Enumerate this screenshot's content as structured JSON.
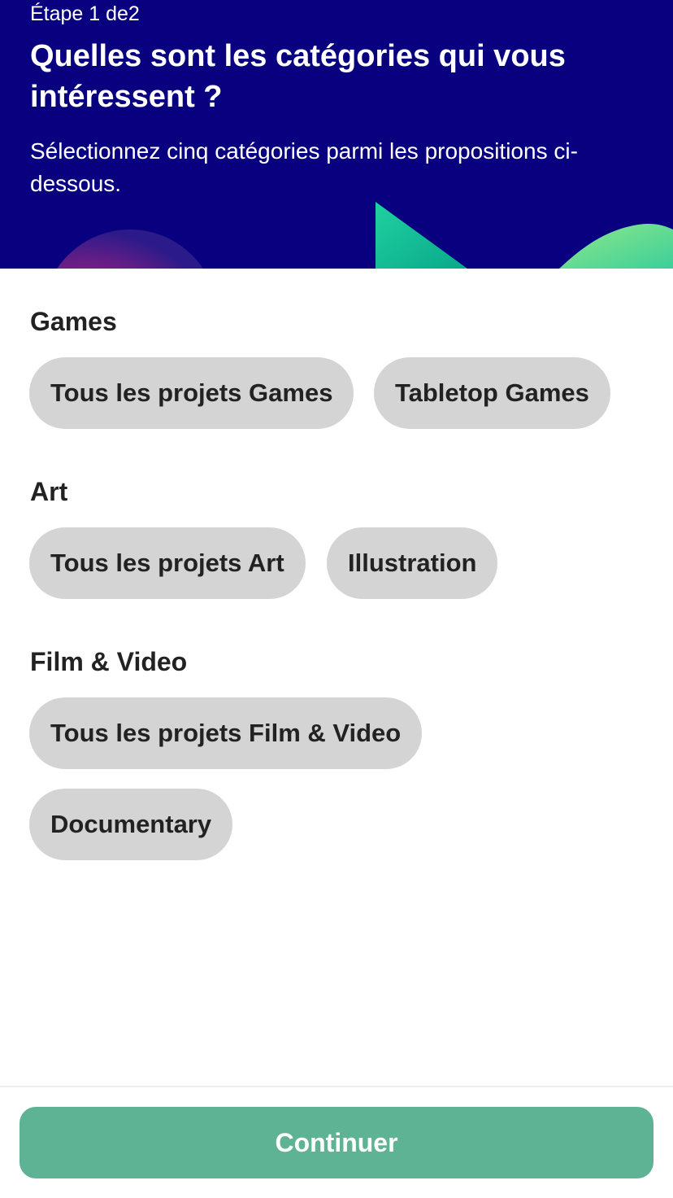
{
  "header": {
    "step_label": "Étape 1 de2",
    "title": "Quelles sont les catégories qui vous intéressent ?",
    "subtitle": "Sélectionnez cinq catégories parmi les propositions ci-dessous.",
    "background_color": "#08007f"
  },
  "sections": [
    {
      "title": "Games",
      "chips": [
        "Tous les projets Games",
        "Tabletop Games"
      ]
    },
    {
      "title": "Art",
      "chips": [
        "Tous les projets Art",
        "Illustration"
      ]
    },
    {
      "title": "Film & Video",
      "chips": [
        "Tous les projets Film & Video",
        "Documentary"
      ]
    }
  ],
  "chip_color": "#d4d4d4",
  "footer": {
    "continue_label": "Continuer",
    "button_color": "#5db393"
  }
}
